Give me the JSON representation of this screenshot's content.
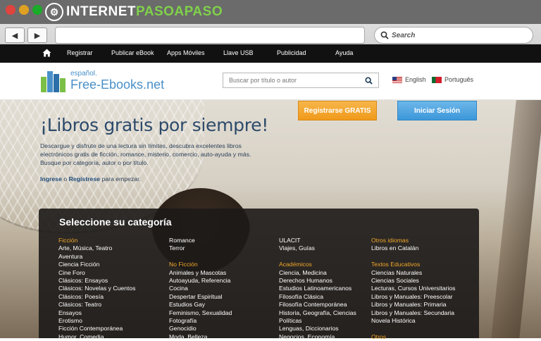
{
  "browser": {
    "brand_part1": "INTERNET",
    "brand_part2": "PASOAPASO",
    "back_label": "◀",
    "forward_label": "▶",
    "search_placeholder": "Search"
  },
  "topnav": {
    "items": [
      "Registrar",
      "Publicar eBook",
      "Apps Móviles",
      "Llave USB",
      "Publicidad",
      "Ayuda"
    ]
  },
  "header": {
    "logo_small": "español.",
    "logo_big": "Free-Ebooks.net",
    "search_placeholder": "Buscar por título o autor",
    "lang_en": "English",
    "lang_pt": "Português"
  },
  "hero": {
    "register_button": "Registrarse GRATIS",
    "login_button": "Iniciar Sesión",
    "headline": "¡Libros gratis por siempre!",
    "description": "Descargue y disfrute de una lectura sin límites, descubra excelentes libros electrónicos gratis de ficción, romance, misterio, comercio, auto-ayuda y más. Busque por categoría, autor o por título.",
    "cta_login": "Ingrese",
    "cta_or": " o ",
    "cta_register": "Regístrese",
    "cta_rest": " para empezar."
  },
  "categories": {
    "title": "Seleccione su categoría",
    "col1": [
      {
        "text": "Ficción",
        "heading": true
      },
      {
        "text": "Arte, Música, Teatro"
      },
      {
        "text": "Aventura"
      },
      {
        "text": "Ciencia Ficción"
      },
      {
        "text": "Cine Foro"
      },
      {
        "text": "Clásicos: Ensayos"
      },
      {
        "text": "Clásicos: Novelas y Cuentos"
      },
      {
        "text": "Clásicos: Poesía"
      },
      {
        "text": "Clásicos: Teatro"
      },
      {
        "text": "Ensayos"
      },
      {
        "text": "Erotismo"
      },
      {
        "text": "Ficción Contemporánea"
      },
      {
        "text": "Humor, Comedia"
      }
    ],
    "col2": [
      {
        "text": "Romance"
      },
      {
        "text": "Terror"
      },
      {
        "text": "",
        "spacer": true
      },
      {
        "text": "No Ficción",
        "heading": true
      },
      {
        "text": "Animales y Mascotas"
      },
      {
        "text": "Autoayuda, Referencia"
      },
      {
        "text": "Cocina"
      },
      {
        "text": "Despertar Espiritual"
      },
      {
        "text": "Estudios Gay"
      },
      {
        "text": "Feminismo, Sexualidad"
      },
      {
        "text": "Fotografía"
      },
      {
        "text": "Genocidio"
      },
      {
        "text": "Moda, Belleza"
      }
    ],
    "col3": [
      {
        "text": "ULACIT"
      },
      {
        "text": "Viajes, Guías"
      },
      {
        "text": "",
        "spacer": true
      },
      {
        "text": "Académicos",
        "heading": true
      },
      {
        "text": "Ciencia, Medicina"
      },
      {
        "text": "Derechos Humanos"
      },
      {
        "text": "Estudios Latinoamericanos"
      },
      {
        "text": "Filosofía Clásica"
      },
      {
        "text": "Filosofía Contemporánea"
      },
      {
        "text": "Historia, Geografía, Ciencias"
      },
      {
        "text": "Políticas"
      },
      {
        "text": "Lenguas, Diccionarios"
      },
      {
        "text": "Negocios, Economía"
      }
    ],
    "col4": [
      {
        "text": "Otros idiomas",
        "heading": true
      },
      {
        "text": "Libros en Catalán"
      },
      {
        "text": "",
        "spacer": true
      },
      {
        "text": "Textos Educativos",
        "heading": true
      },
      {
        "text": "Ciencias Naturales"
      },
      {
        "text": "Ciencias Sociales"
      },
      {
        "text": "Lecturas, Cursos Universitarios"
      },
      {
        "text": "Libros y Manuales: Preescolar"
      },
      {
        "text": "Libros y Manuales: Primaria"
      },
      {
        "text": "Libros y Manuales: Secundaria"
      },
      {
        "text": "Novela Histórica"
      },
      {
        "text": "",
        "spacer": true
      },
      {
        "text": "Otros",
        "heading": true
      }
    ]
  }
}
